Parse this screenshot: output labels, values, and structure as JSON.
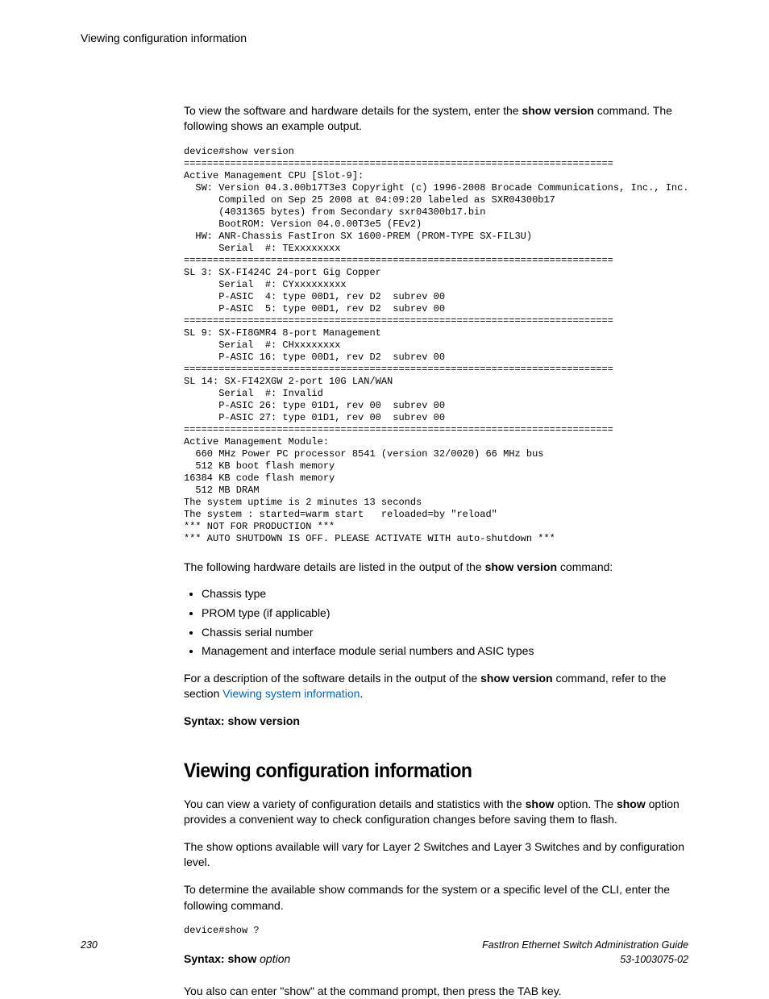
{
  "running_head": "Viewing configuration information",
  "intro_1a": "To view the software and hardware details for the system, enter the ",
  "intro_1_cmd": "show version",
  "intro_1b": " command. The following shows an example output.",
  "code1": "device#show version\n==========================================================================\nActive Management CPU [Slot-9]:\n  SW: Version 04.3.00b17T3e3 Copyright (c) 1996-2008 Brocade Communications, Inc., Inc.\n      Compiled on Sep 25 2008 at 04:09:20 labeled as SXR04300b17\n      (4031365 bytes) from Secondary sxr04300b17.bin\n      BootROM: Version 04.0.00T3e5 (FEv2)\n  HW: ANR-Chassis FastIron SX 1600-PREM (PROM-TYPE SX-FIL3U)\n      Serial  #: TExxxxxxxx\n==========================================================================\nSL 3: SX-FI424C 24-port Gig Copper\n      Serial  #: CYxxxxxxxxx\n      P-ASIC  4: type 00D1, rev D2  subrev 00\n      P-ASIC  5: type 00D1, rev D2  subrev 00\n==========================================================================\nSL 9: SX-FI8GMR4 8-port Management\n      Serial  #: CHxxxxxxxx\n      P-ASIC 16: type 00D1, rev D2  subrev 00\n==========================================================================\nSL 14: SX-FI42XGW 2-port 10G LAN/WAN\n      Serial  #: Invalid\n      P-ASIC 26: type 01D1, rev 00  subrev 00\n      P-ASIC 27: type 01D1, rev 00  subrev 00\n==========================================================================\nActive Management Module:\n  660 MHz Power PC processor 8541 (version 32/0020) 66 MHz bus\n  512 KB boot flash memory\n16384 KB code flash memory\n  512 MB DRAM\nThe system uptime is 2 minutes 13 seconds\nThe system : started=warm start   reloaded=by \"reload\"\n*** NOT FOR PRODUCTION ***\n*** AUTO SHUTDOWN IS OFF. PLEASE ACTIVATE WITH auto-shutdown ***",
  "after_code_a": "The following hardware details are listed in the output of the ",
  "after_code_cmd": "show version",
  "after_code_b": " command:",
  "bullets": [
    "Chassis type",
    "PROM type (if applicable)",
    "Chassis serial number",
    "Management and interface module serial numbers and ASIC types"
  ],
  "desc_a": "For a description of the software details in the output of the ",
  "desc_cmd": "show version",
  "desc_b": " command, refer to the section ",
  "desc_link": "Viewing system information",
  "desc_c": ".",
  "syntax1": "Syntax: show version",
  "heading2": "Viewing configuration information",
  "sec2_p1a": "You can view a variety of configuration details and statistics with the ",
  "sec2_p1_cmd": "show",
  "sec2_p1b": " option. The ",
  "sec2_p1_cmd2": "show",
  "sec2_p1c": " option provides a convenient way to check configuration changes before saving them to flash.",
  "sec2_p2": "The show options available will vary for Layer 2 Switches and Layer 3 Switches and by configuration level.",
  "sec2_p3": "To determine the available show commands for the system or a specific level of the CLI, enter the following command.",
  "code2": "device#show ?",
  "syntax2a": "Syntax: show ",
  "syntax2b": "option",
  "sec2_p4": "You also can enter \"show\" at the command prompt, then press the TAB key.",
  "footer": {
    "page": "230",
    "title": "FastIron Ethernet Switch Administration Guide",
    "docnum": "53-1003075-02"
  }
}
